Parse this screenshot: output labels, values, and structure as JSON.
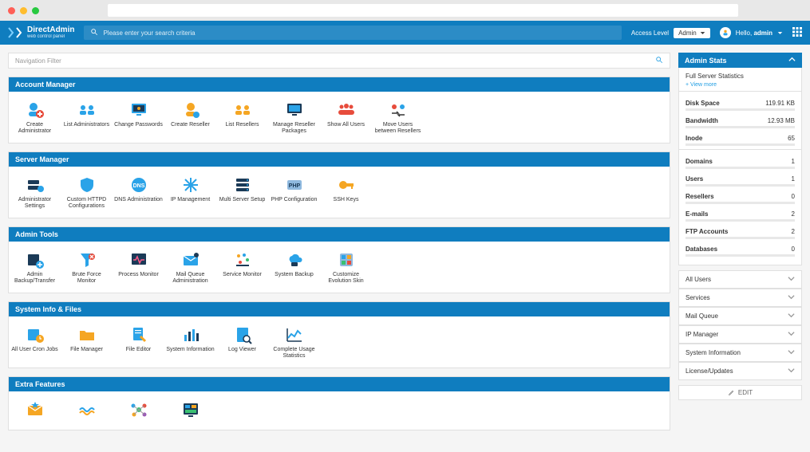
{
  "header": {
    "brand_main": "DirectAdmin",
    "brand_sub": "web control panel",
    "search_placeholder": "Please enter your search criteria",
    "access_label": "Access Level",
    "access_value": "Admin",
    "hello_prefix": "Hello,",
    "hello_user": "admin"
  },
  "nav_filter_placeholder": "Navigation Filter",
  "sections": [
    {
      "title": "Account Manager",
      "items": [
        {
          "label": "Create Administrator",
          "icon": "user-plus"
        },
        {
          "label": "List Administrators",
          "icon": "users"
        },
        {
          "label": "Change Passwords",
          "icon": "monitor-key"
        },
        {
          "label": "Create Reseller",
          "icon": "user-gear"
        },
        {
          "label": "List Resellers",
          "icon": "users-orange"
        },
        {
          "label": "Manage Reseller Packages",
          "icon": "monitor-pkg"
        },
        {
          "label": "Show All Users",
          "icon": "crowd"
        },
        {
          "label": "Move Users between Resellers",
          "icon": "swap-users"
        }
      ]
    },
    {
      "title": "Server Manager",
      "items": [
        {
          "label": "Administrator Settings",
          "icon": "server-gear"
        },
        {
          "label": "Custom HTTPD Configurations",
          "icon": "shield"
        },
        {
          "label": "DNS Administration",
          "icon": "dns"
        },
        {
          "label": "IP Management",
          "icon": "snowflake"
        },
        {
          "label": "Multi Server Setup",
          "icon": "servers"
        },
        {
          "label": "PHP Configuration",
          "icon": "php"
        },
        {
          "label": "SSH Keys",
          "icon": "key"
        }
      ]
    },
    {
      "title": "Admin Tools",
      "items": [
        {
          "label": "Admin Backup/Transfer",
          "icon": "backup"
        },
        {
          "label": "Brute Force Monitor",
          "icon": "funnel-x"
        },
        {
          "label": "Process Monitor",
          "icon": "pulse"
        },
        {
          "label": "Mail Queue Administration",
          "icon": "mail-queue"
        },
        {
          "label": "Service Monitor",
          "icon": "dots"
        },
        {
          "label": "System Backup",
          "icon": "cloud-backup"
        },
        {
          "label": "Customize Evolution Skin",
          "icon": "customize"
        }
      ]
    },
    {
      "title": "System Info & Files",
      "items": [
        {
          "label": "All User Cron Jobs",
          "icon": "cron"
        },
        {
          "label": "File Manager",
          "icon": "folder"
        },
        {
          "label": "File Editor",
          "icon": "file-edit"
        },
        {
          "label": "System Information",
          "icon": "bars"
        },
        {
          "label": "Log Viewer",
          "icon": "log"
        },
        {
          "label": "Complete Usage Statistics",
          "icon": "graph"
        }
      ]
    },
    {
      "title": "Extra Features",
      "items": [
        {
          "label": "",
          "icon": "mail-star"
        },
        {
          "label": "",
          "icon": "waves"
        },
        {
          "label": "",
          "icon": "molecule"
        },
        {
          "label": "",
          "icon": "dashboard"
        }
      ]
    }
  ],
  "sidebar": {
    "panel_title": "Admin Stats",
    "full_stats": "Full Server Statistics",
    "view_more": "+ View more",
    "metrics": [
      {
        "k": "Disk Space",
        "v": "119.91 KB"
      },
      {
        "k": "Bandwidth",
        "v": "12.93 MB"
      },
      {
        "k": "Inode",
        "v": "65"
      }
    ],
    "counts": [
      {
        "k": "Domains",
        "v": "1"
      },
      {
        "k": "Users",
        "v": "1"
      },
      {
        "k": "Resellers",
        "v": "0"
      },
      {
        "k": "E-mails",
        "v": "2"
      },
      {
        "k": "FTP Accounts",
        "v": "2"
      },
      {
        "k": "Databases",
        "v": "0"
      }
    ],
    "accordions": [
      "All Users",
      "Services",
      "Mail Queue",
      "IP Manager",
      "System Information",
      "License/Updates"
    ],
    "edit_label": "EDIT"
  }
}
